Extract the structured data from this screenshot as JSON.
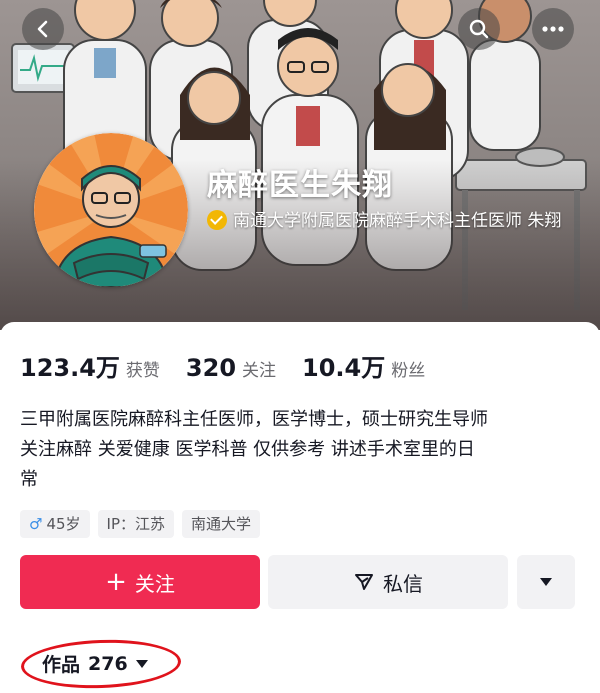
{
  "profile": {
    "name": "麻醉医生朱翔",
    "verification": "南通大学附属医院麻醉手术科主任医师 朱翔",
    "verified_color": "#f2b705"
  },
  "header": {
    "back_icon": "chevron-left-icon",
    "search_icon": "search-icon",
    "more_icon": "more-dots-icon"
  },
  "stats": [
    {
      "value": "123.4万",
      "label": "获赞"
    },
    {
      "value": "320",
      "label": "关注"
    },
    {
      "value": "10.4万",
      "label": "粉丝"
    }
  ],
  "bio": [
    "三甲附属医院麻醉科主任医师，医学博士，硕士研究生导师",
    "关注麻醉 关爱健康 医学科普 仅供参考 讲述手术室里的日",
    "常"
  ],
  "tags": {
    "gender_icon": "♂",
    "age": "45岁",
    "ip": "IP：江苏",
    "school": "南通大学"
  },
  "actions": {
    "follow_icon": "+",
    "follow_label": "关注",
    "message_label": "私信",
    "follow_color": "#f02b52"
  },
  "works": {
    "label": "作品",
    "count": "276"
  },
  "annotation_color": "#e0131c"
}
